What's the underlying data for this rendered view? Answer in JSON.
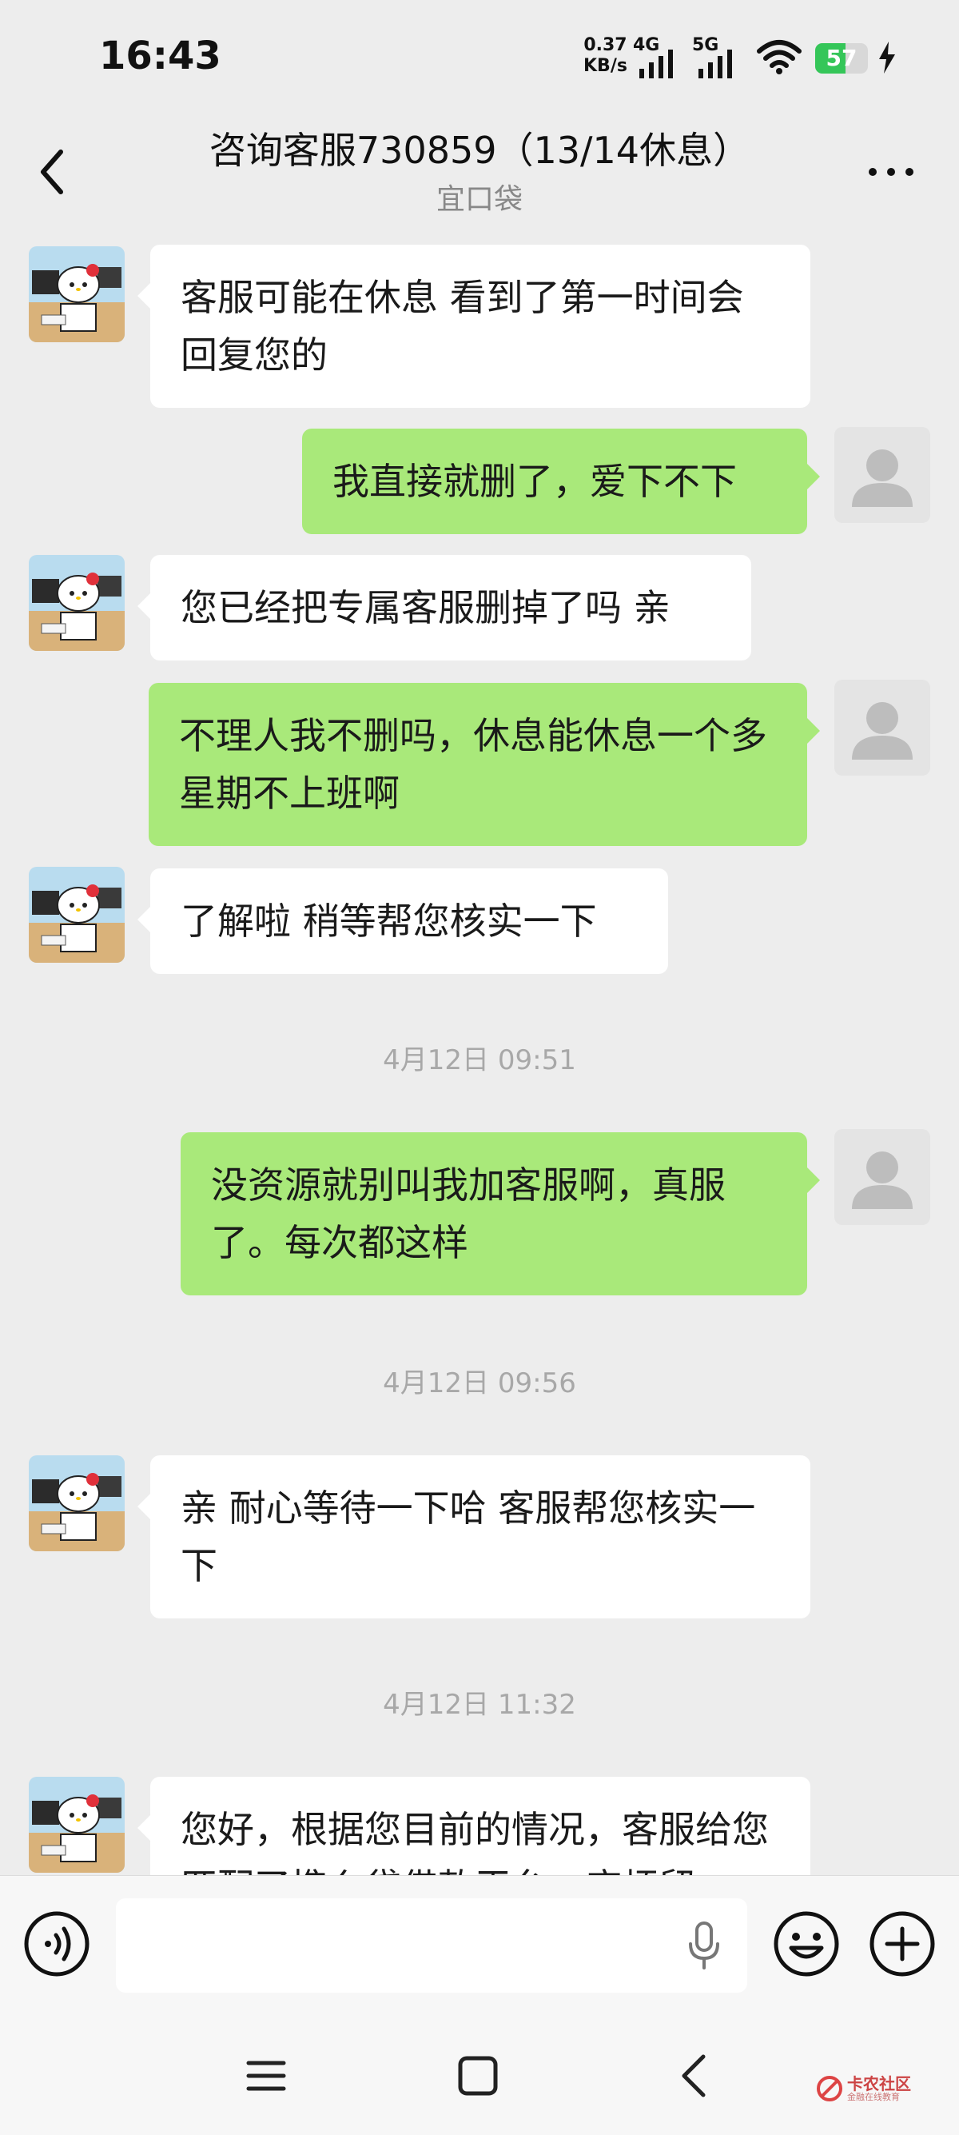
{
  "status_bar": {
    "time": "16:43",
    "net_speed_value": "0.37",
    "net_speed_unit": "KB/s",
    "sim1_label": "4G",
    "sim2_label": "5G",
    "battery_level": "57",
    "battery_color": "#35c659"
  },
  "header": {
    "title": "咨询客服730859（13/14休息）",
    "subtitle": "宜口袋"
  },
  "messages": [
    {
      "side": "left",
      "text": "客服可能在休息 看到了第一时间会回复您的"
    },
    {
      "side": "right",
      "text": "我直接就删了，爱下不下"
    },
    {
      "side": "left",
      "text": "您已经把专属客服删掉了吗 亲"
    },
    {
      "side": "right",
      "text": "不理人我不删吗，休息能休息一个多星期不上班啊"
    },
    {
      "side": "left",
      "text": "了解啦 稍等帮您核实一下"
    },
    {
      "type": "time",
      "text": "4月12日 09:51"
    },
    {
      "side": "right",
      "text": "没资源就别叫我加客服啊，真服了。每次都这样"
    },
    {
      "type": "time",
      "text": "4月12日 09:56"
    },
    {
      "side": "left",
      "text": "亲 耐心等待一下哈 客服帮您核实一下"
    },
    {
      "type": "time",
      "text": "4月12日 11:32"
    },
    {
      "side": "left",
      "text": "您好，根据您目前的情况，客服给您匹配了携么贷借款平台，麻烦留"
    }
  ],
  "input": {
    "value": "",
    "placeholder": ""
  },
  "icons": {
    "back": "chevron-left-icon",
    "more": "more-icon",
    "voice": "voice-icon",
    "mic": "mic-icon",
    "emoji": "emoji-icon",
    "plus": "plus-icon"
  },
  "colors": {
    "background": "#ededed",
    "bubble_self": "#a9e97a",
    "bubble_other": "#ffffff"
  },
  "watermark": {
    "title": "卡农社区",
    "subtitle": "金融在线教育"
  }
}
